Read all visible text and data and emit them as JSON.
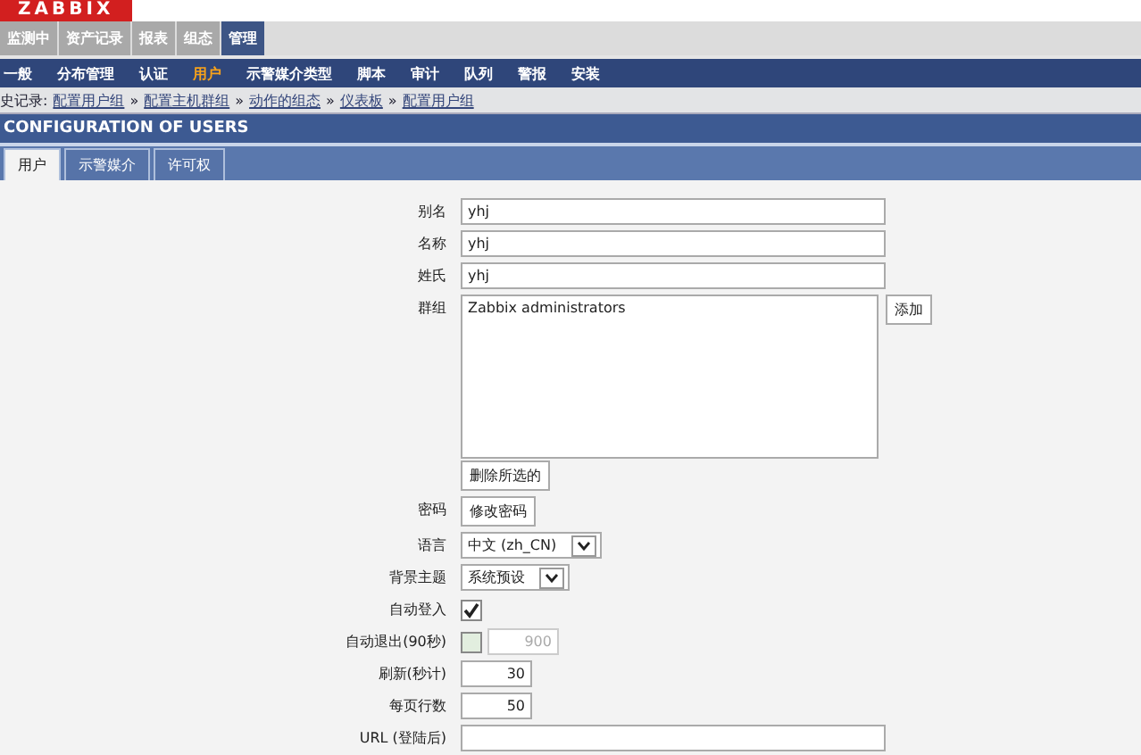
{
  "logo": "ZABBIX",
  "main_menu": [
    {
      "label": "监测中",
      "selected": false
    },
    {
      "label": "资产记录",
      "selected": false
    },
    {
      "label": "报表",
      "selected": false
    },
    {
      "label": "组态",
      "selected": false
    },
    {
      "label": "管理",
      "selected": true
    }
  ],
  "sub_menu": [
    {
      "label": "一般",
      "selected": false
    },
    {
      "label": "分布管理",
      "selected": false
    },
    {
      "label": "认证",
      "selected": false
    },
    {
      "label": "用户",
      "selected": true
    },
    {
      "label": "示警媒介类型",
      "selected": false
    },
    {
      "label": "脚本",
      "selected": false
    },
    {
      "label": "审计",
      "selected": false
    },
    {
      "label": "队列",
      "selected": false
    },
    {
      "label": "警报",
      "selected": false
    },
    {
      "label": "安装",
      "selected": false
    }
  ],
  "history": {
    "label": "史记录:",
    "links": [
      "配置用户组",
      "配置主机群组",
      "动作的组态",
      "仪表板",
      "配置用户组"
    ],
    "separator": "»"
  },
  "page_title": "CONFIGURATION OF USERS",
  "tabs": [
    {
      "label": "用户",
      "selected": true
    },
    {
      "label": "示警媒介",
      "selected": false
    },
    {
      "label": "许可权",
      "selected": false
    }
  ],
  "form": [
    {
      "kind": "text",
      "label": "别名",
      "value": "yhj"
    },
    {
      "kind": "text",
      "label": "名称",
      "value": "yhj"
    },
    {
      "kind": "text",
      "label": "姓氏",
      "value": "yhj"
    },
    {
      "kind": "groups",
      "label": "群组",
      "items": [
        "Zabbix administrators"
      ],
      "add_button": "添加",
      "remove_button": "删除所选的"
    },
    {
      "kind": "button",
      "label": "密码",
      "button": "修改密码"
    },
    {
      "kind": "select",
      "label": "语言",
      "value": "中文 (zh_CN)"
    },
    {
      "kind": "select",
      "label": "背景主题",
      "value": "系统预设"
    },
    {
      "kind": "checkbox",
      "label": "自动登入",
      "checked": true
    },
    {
      "kind": "checkbox_number",
      "label": "自动退出(90秒)",
      "checked": false,
      "value": "900"
    },
    {
      "kind": "number",
      "label": "刷新(秒计)",
      "value": "30"
    },
    {
      "kind": "number",
      "label": "每页行数",
      "value": "50"
    },
    {
      "kind": "text",
      "label": "URL (登陆后)"
    }
  ]
}
